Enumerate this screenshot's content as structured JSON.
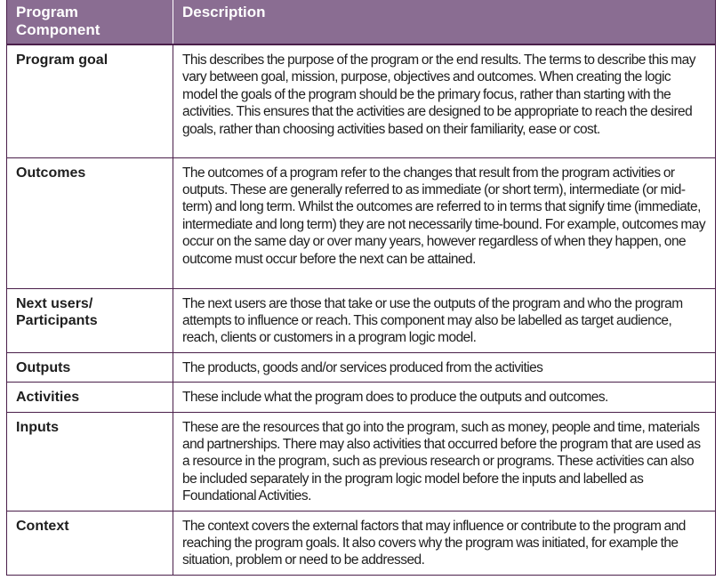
{
  "table": {
    "headers": [
      "Program Component",
      "Description"
    ],
    "header_line1": "Program",
    "header_line2": "Component",
    "accent_color": "#8a6d92",
    "border_color": "#4a1f4a",
    "rows": [
      {
        "component": "Program goal",
        "description": "This describes the purpose of the program or the end results. The terms to describe this may vary between goal, mission, purpose, objectives and outcomes. When creating the logic model the goals of the program should be the primary focus, rather than starting with the activities. This ensures that the activities are designed to be appropriate to reach the desired goals, rather than choosing activities based on their familiarity, ease or cost."
      },
      {
        "component": "Outcomes",
        "description": "The outcomes of a program refer to the changes that result from the program activities or outputs. These are generally referred to as immediate (or short term), intermediate (or mid-term) and long term. Whilst the outcomes are referred to in terms that signify time (immediate, intermediate and long term) they are not necessarily time-bound. For example, outcomes may occur on the same day or over many years, however regardless of when they happen, one outcome must occur before the next can be attained."
      },
      {
        "component": "Next users/ Participants",
        "description": "The next users are those that take or use the outputs of the program and who the program attempts to influence or reach. This component may also be labelled as target audience, reach, clients or customers in a program logic model."
      },
      {
        "component": "Outputs",
        "description": "The products, goods and/or services produced from the activities"
      },
      {
        "component": "Activities",
        "description": "These include what the program does to produce the outputs and outcomes."
      },
      {
        "component": "Inputs",
        "description": "These are the resources that go into the program, such as money, people and time, materials and partnerships. There may also activities that occurred before the program that are used as a resource in the program, such as previous research or programs. These activities can also be included separately in the program logic model before the inputs and labelled as Foundational Activities."
      },
      {
        "component": "Context",
        "description": "The context covers the external factors that may influence or contribute to the program and reaching the program goals. It also covers why the program was initiated, for example the situation, problem or need to be addressed."
      }
    ]
  }
}
